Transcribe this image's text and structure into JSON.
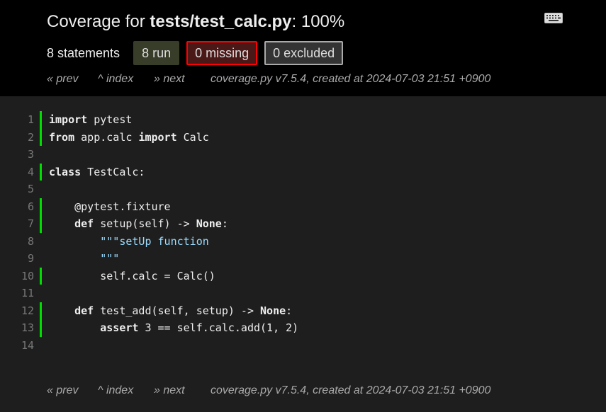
{
  "header": {
    "title_prefix": "Coverage for ",
    "title_file": "tests/test_calc.py",
    "title_suffix": ": 100%",
    "statements": "8 statements",
    "run_label": "8 run",
    "missing_label": "0 missing",
    "excluded_label": "0 excluded",
    "keyboard_icon": "keyboard-icon"
  },
  "nav": {
    "prev": "« prev",
    "index": "^ index",
    "next": "» next",
    "created": "coverage.py v7.5.4, created at 2024-07-03 21:51 +0900"
  },
  "colors": {
    "header_bg": "#000000",
    "body_bg": "#1e1e1e",
    "run_marker": "#00dd00",
    "missing_border": "#ff0000",
    "string": "#9cdcfe"
  },
  "lines": [
    {
      "n": "1",
      "run": true,
      "tokens": [
        [
          "kw",
          "import"
        ],
        [
          "t",
          " pytest"
        ]
      ]
    },
    {
      "n": "2",
      "run": true,
      "tokens": [
        [
          "kw",
          "from"
        ],
        [
          "t",
          " app.calc "
        ],
        [
          "kw",
          "import"
        ],
        [
          "t",
          " Calc"
        ]
      ]
    },
    {
      "n": "3",
      "run": false,
      "tokens": []
    },
    {
      "n": "4",
      "run": true,
      "tokens": [
        [
          "kw",
          "class"
        ],
        [
          "t",
          " TestCalc:"
        ]
      ]
    },
    {
      "n": "5",
      "run": false,
      "tokens": []
    },
    {
      "n": "6",
      "run": true,
      "tokens": [
        [
          "t",
          "    @pytest.fixture"
        ]
      ]
    },
    {
      "n": "7",
      "run": true,
      "tokens": [
        [
          "t",
          "    "
        ],
        [
          "kw",
          "def"
        ],
        [
          "t",
          " setup(self) -> "
        ],
        [
          "kw",
          "None"
        ],
        [
          "t",
          ":"
        ]
      ]
    },
    {
      "n": "8",
      "run": false,
      "tokens": [
        [
          "str",
          "        \"\"\"setUp function"
        ]
      ]
    },
    {
      "n": "9",
      "run": false,
      "tokens": [
        [
          "str",
          "        \"\"\""
        ]
      ]
    },
    {
      "n": "10",
      "run": true,
      "tokens": [
        [
          "t",
          "        self.calc = Calc()"
        ]
      ]
    },
    {
      "n": "11",
      "run": false,
      "tokens": []
    },
    {
      "n": "12",
      "run": true,
      "tokens": [
        [
          "t",
          "    "
        ],
        [
          "kw",
          "def"
        ],
        [
          "t",
          " test_add(self, setup) -> "
        ],
        [
          "kw",
          "None"
        ],
        [
          "t",
          ":"
        ]
      ]
    },
    {
      "n": "13",
      "run": true,
      "tokens": [
        [
          "t",
          "        "
        ],
        [
          "kw",
          "assert"
        ],
        [
          "t",
          " 3 == self.calc.add(1, 2)"
        ]
      ]
    },
    {
      "n": "14",
      "run": false,
      "tokens": []
    }
  ]
}
